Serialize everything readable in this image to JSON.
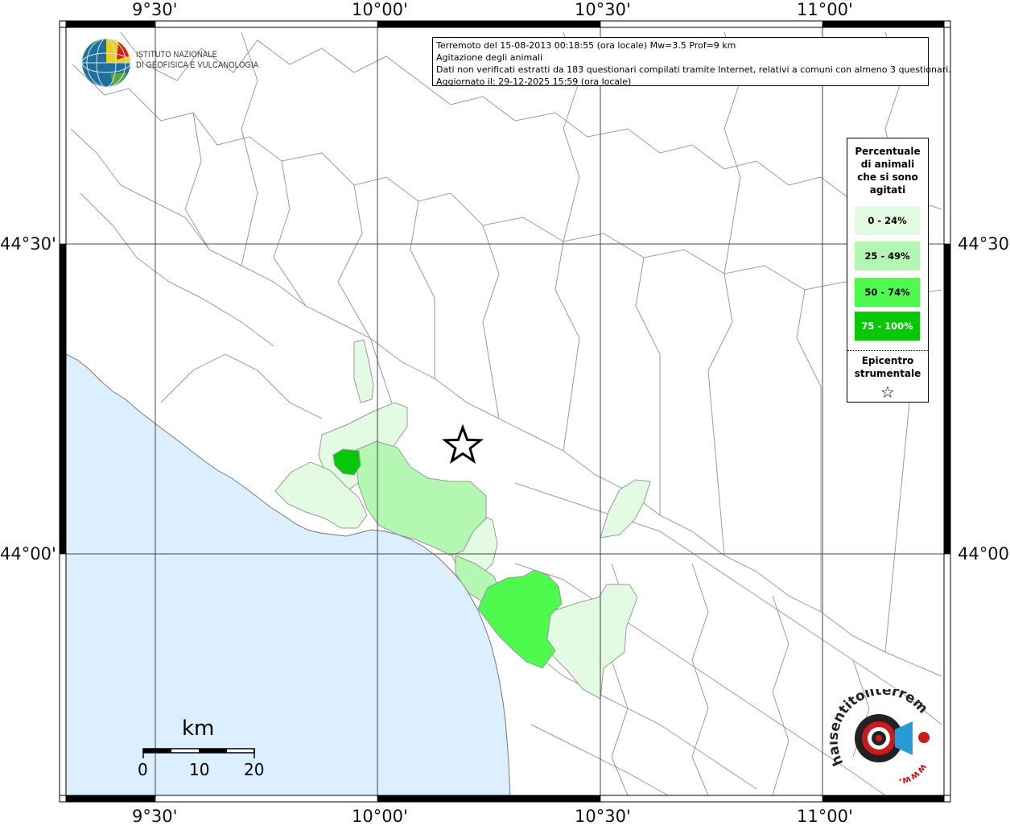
{
  "header": {
    "info_line1": "Terremoto del 15-08-2013 00:18:55 (ora locale) Mw=3.5 Prof=9 km",
    "info_line2": "Agitazione degli animali",
    "info_line3": "Dati non verificati estratti da 183 questionari compilati tramite Internet, relativi a comuni con almeno 3 questionari.",
    "info_line4": "Aggiornato il: 29-12-2025 15:59 (ora locale)"
  },
  "institute": {
    "line1": "ISTITUTO NAZIONALE",
    "line2": "DI GEOFISICA E VULCANOLOGIA"
  },
  "axes": {
    "lon_labels": [
      "9°30'",
      "10°00'",
      "10°30'",
      "11°00'"
    ],
    "lat_labels": [
      "44°30'",
      "44°00'"
    ]
  },
  "legend": {
    "title": "Percentuale di animali che si sono agitati",
    "items": [
      {
        "label": "0 - 24%",
        "color": "#e3fae3"
      },
      {
        "label": "25 - 49%",
        "color": "#b3f7b3"
      },
      {
        "label": "50 - 74%",
        "color": "#4dfa4d"
      },
      {
        "label": "75 - 100%",
        "color": "#07c807"
      }
    ],
    "epicenter_label": "Epicentro strumentale",
    "epicenter_symbol": "☆"
  },
  "scale_bar": {
    "unit": "km",
    "ticks": [
      "0",
      "10",
      "20"
    ]
  },
  "logo": {
    "text_main": "haisentitoilterremoto.it",
    "text_www": "www."
  },
  "colors": {
    "sea": "#dcefff",
    "border_lines": "#9a9a9a",
    "grid": "#555555"
  }
}
